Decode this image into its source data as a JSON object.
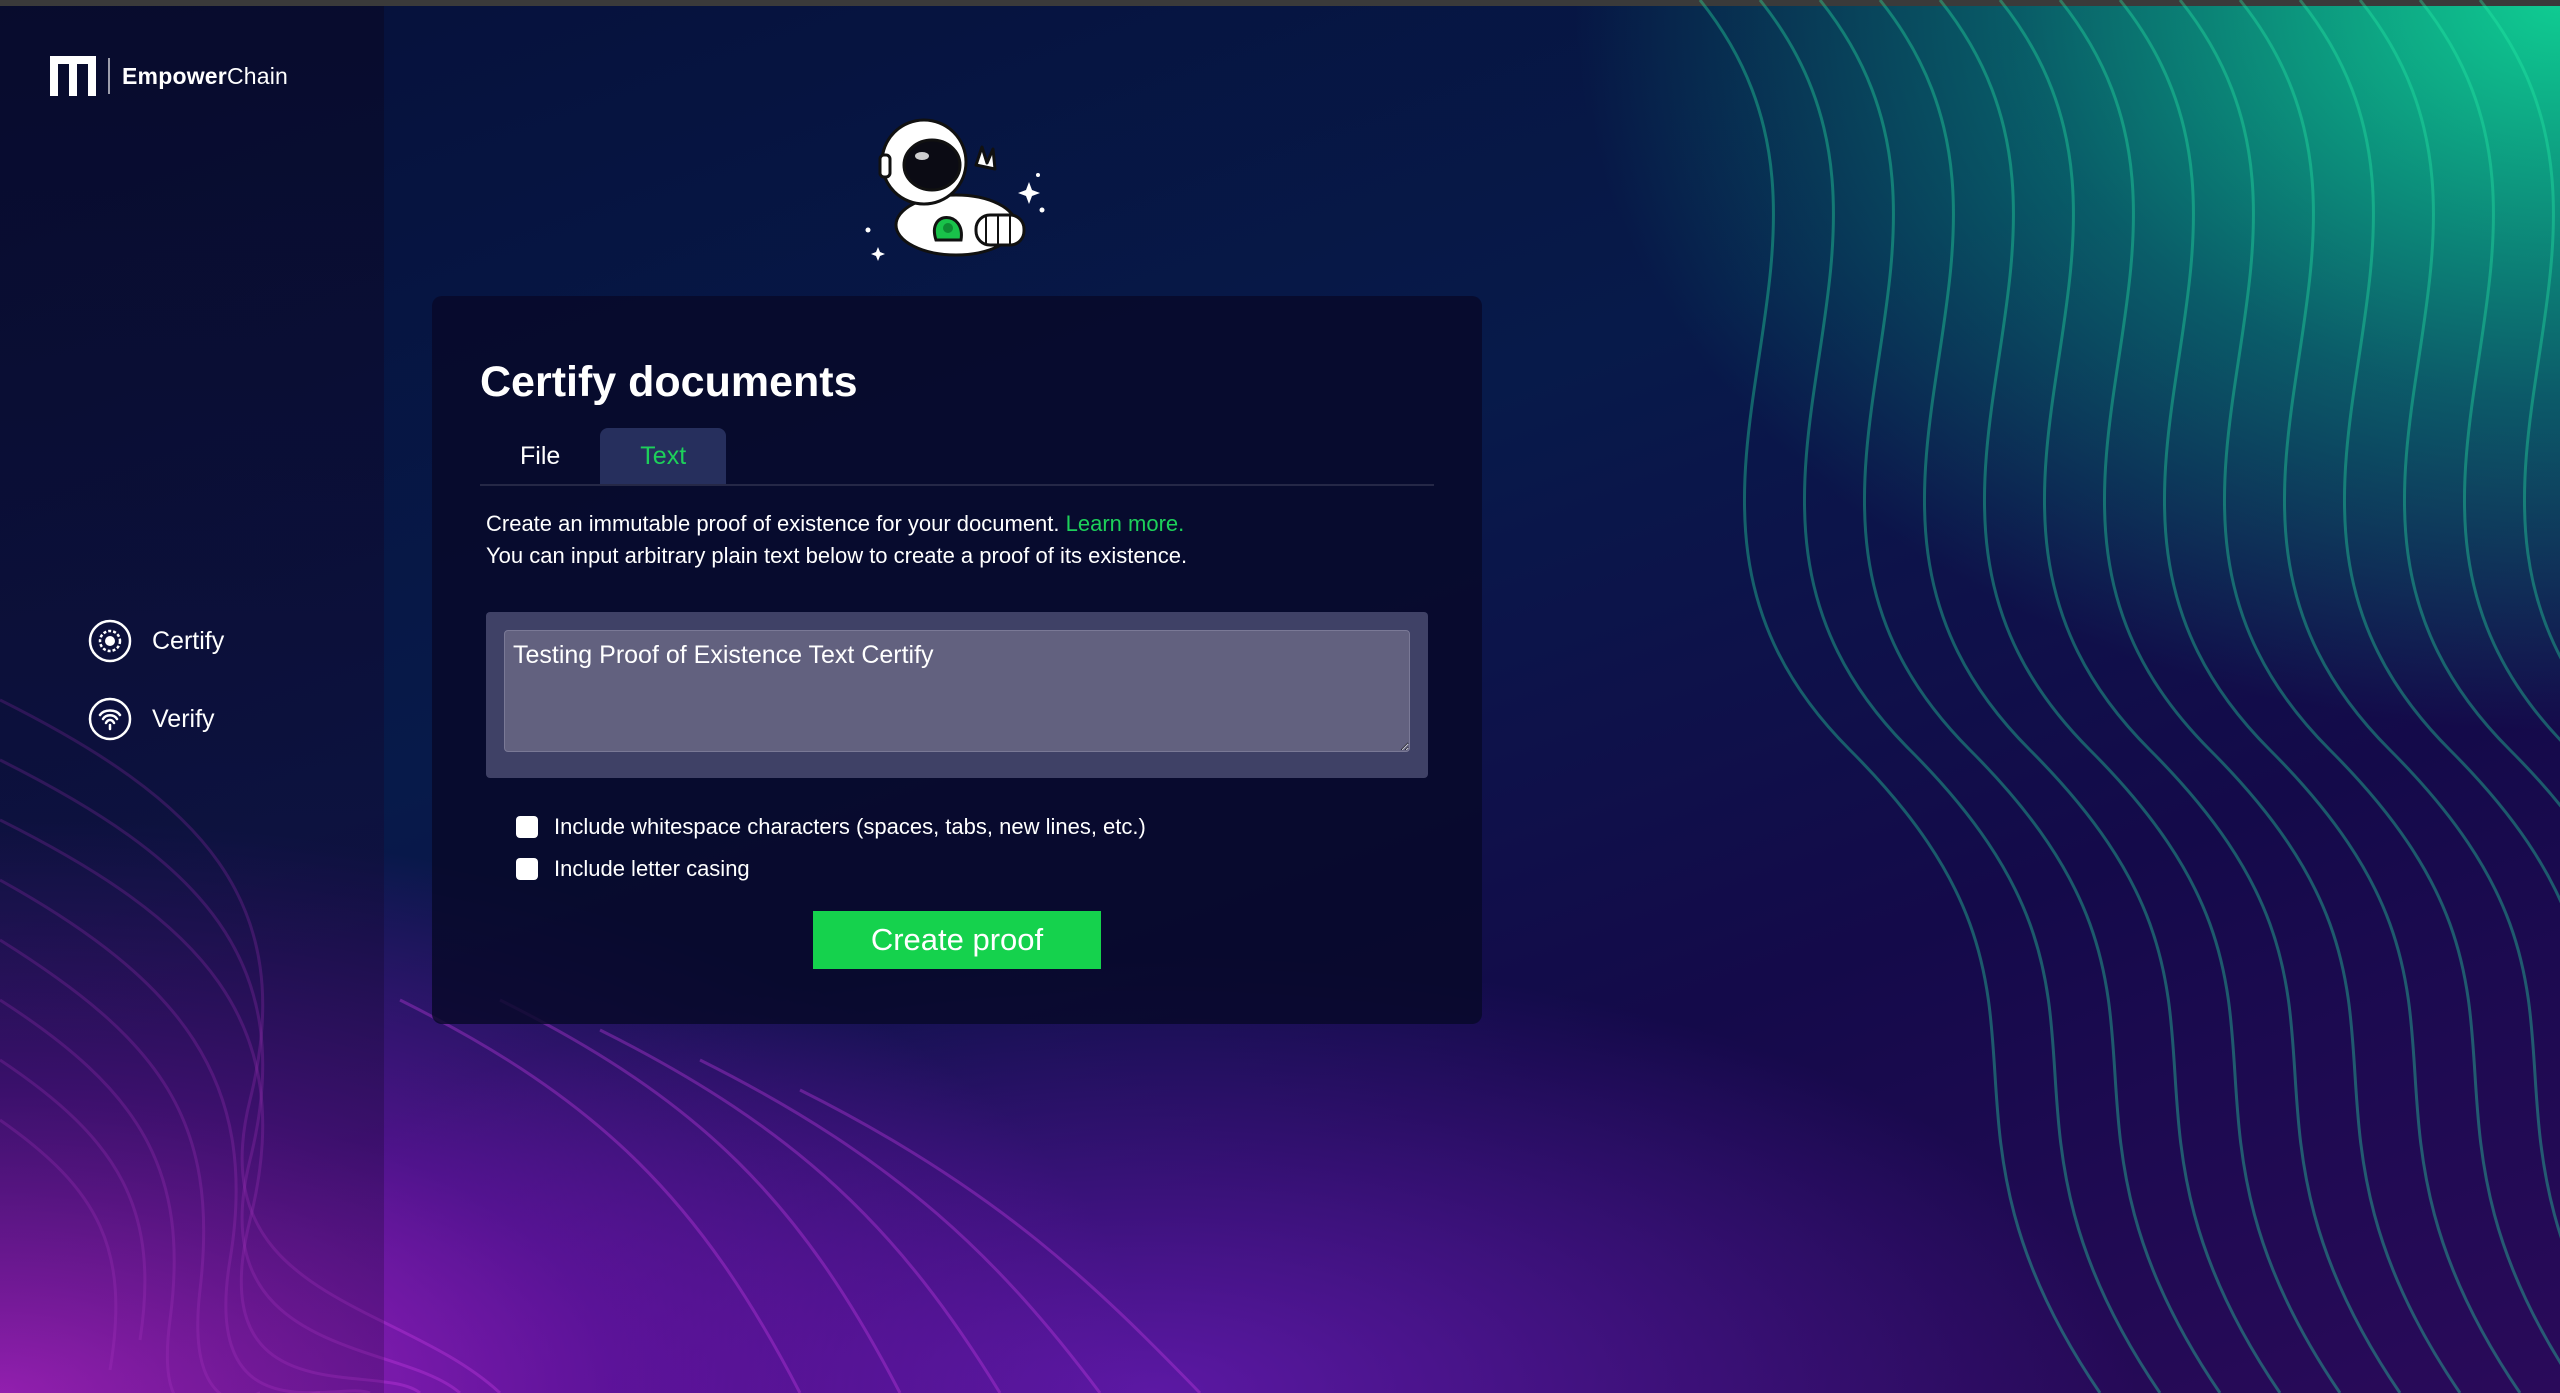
{
  "app": {
    "brand_bold": "Empower",
    "brand_regular": "Chain"
  },
  "sidebar": {
    "items": [
      {
        "label": "Certify",
        "icon": "certify-icon"
      },
      {
        "label": "Verify",
        "icon": "verify-icon"
      }
    ]
  },
  "card": {
    "title": "Certify documents",
    "tabs": [
      {
        "label": "File",
        "active": false
      },
      {
        "label": "Text",
        "active": true
      }
    ],
    "description_line1": "Create an immutable proof of existence for your document.",
    "learn_more": "Learn more.",
    "description_line2": "You can input arbitrary plain text below to create a proof of its existence.",
    "text_value": "Testing Proof of Existence Text Certify",
    "checkboxes": [
      {
        "label": "Include whitespace characters (spaces, tabs, new lines, etc.)",
        "checked": false
      },
      {
        "label": "Include letter casing",
        "checked": false
      }
    ],
    "submit_label": "Create proof"
  },
  "colors": {
    "accent_green": "#1dd05a",
    "button_green": "#15d24d",
    "card_bg": "#07082a"
  },
  "icons": {
    "logo": "empowerchain-logo-icon",
    "mascot": "astronaut-mascot-icon"
  }
}
